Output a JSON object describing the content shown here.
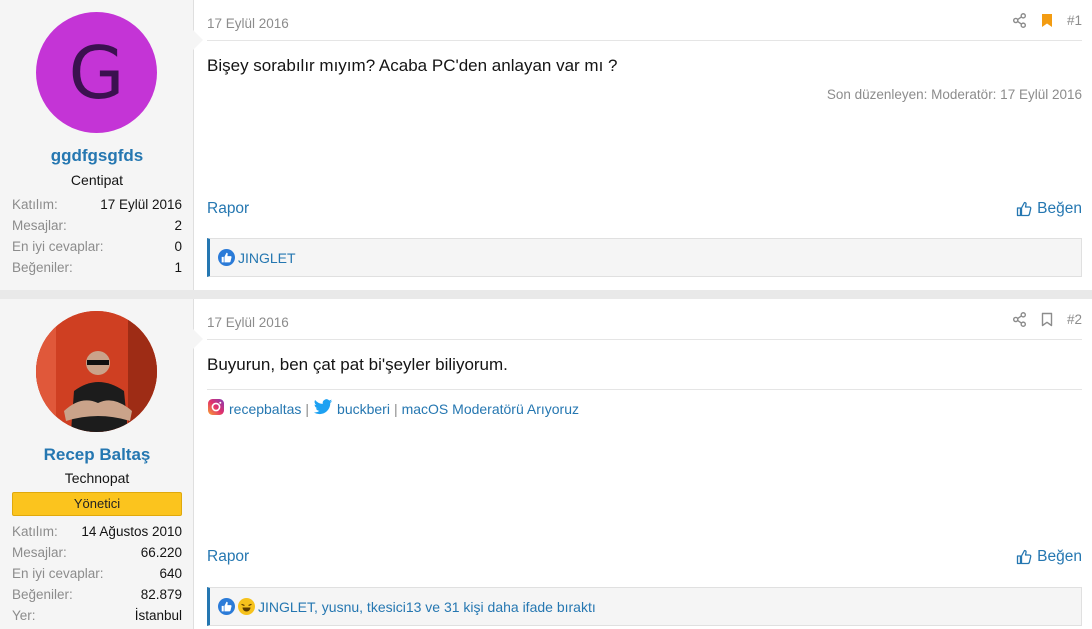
{
  "posts": [
    {
      "user": {
        "avatar_letter": "G",
        "avatar_color": "#c434d6",
        "name": "ggdfgsgfds",
        "title": "Centipat"
      },
      "stats": [
        {
          "k": "Katılım:",
          "v": "17 Eylül 2016"
        },
        {
          "k": "Mesajlar:",
          "v": "2"
        },
        {
          "k": "En iyi cevaplar:",
          "v": "0"
        },
        {
          "k": "Beğeniler:",
          "v": "1"
        }
      ],
      "date": "17 Eylül 2016",
      "number": "#1",
      "bookmarked": true,
      "text": "Bişey sorabılır mıyım? Acaba PC'den anlayan var mı ?",
      "edited": "Son düzenleyen: Moderatör: 17 Eylül 2016",
      "report": "Rapor",
      "like": "Beğen",
      "reactions": "JINGLET"
    },
    {
      "user": {
        "name": "Recep Baltaş",
        "title": "Technopat",
        "role": "Yönetici"
      },
      "stats": [
        {
          "k": "Katılım:",
          "v": "14 Ağustos 2010"
        },
        {
          "k": "Mesajlar:",
          "v": "66.220"
        },
        {
          "k": "En iyi cevaplar:",
          "v": "640"
        },
        {
          "k": "Beğeniler:",
          "v": "82.879"
        },
        {
          "k": "Yer:",
          "v": "İstanbul"
        }
      ],
      "date": "17 Eylül 2016",
      "number": "#2",
      "bookmarked": false,
      "text": "Buyurun, ben çat pat bi'şeyler biliyorum.",
      "signature": {
        "instagram": "recepbaltas",
        "sep": "|",
        "twitter": "buckberi",
        "tail": "macOS Moderatörü Arıyoruz"
      },
      "report": "Rapor",
      "like": "Beğen",
      "reactions": "JINGLET, yusnu, tkesici13 ve 31 kişi daha ifade bıraktı"
    }
  ],
  "colors": {
    "link": "#2577b1",
    "muted": "#8c8c8c",
    "bookmark": "#f39c12",
    "role_banner": "#fbc41e"
  }
}
